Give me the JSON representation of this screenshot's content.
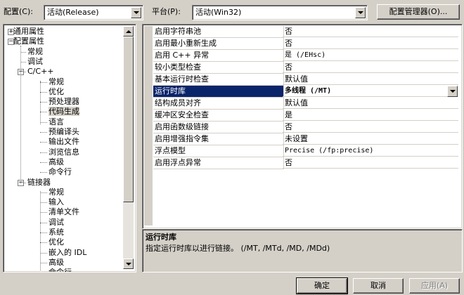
{
  "config": {
    "label": "配置(C):",
    "value": "活动(Release)"
  },
  "platform": {
    "label": "平台(P):",
    "value": "活动(Win32)"
  },
  "config_manager_button": "配置管理器(O)...",
  "tree": [
    {
      "text": "通用属性",
      "depth": 0,
      "expander": "+",
      "key": "common"
    },
    {
      "text": "配置属性",
      "depth": 0,
      "expander": "-",
      "key": "config"
    },
    {
      "text": "常规",
      "depth": 1,
      "key": "general"
    },
    {
      "text": "调试",
      "depth": 1,
      "key": "debugging"
    },
    {
      "text": "C/C++",
      "depth": 1,
      "expander": "-",
      "key": "cpp"
    },
    {
      "text": "常规",
      "depth": 2,
      "key": "cpp-general"
    },
    {
      "text": "优化",
      "depth": 2,
      "key": "cpp-optimization"
    },
    {
      "text": "预处理器",
      "depth": 2,
      "key": "cpp-preprocessor"
    },
    {
      "text": "代码生成",
      "depth": 2,
      "key": "cpp-codegen",
      "selected": true
    },
    {
      "text": "语言",
      "depth": 2,
      "key": "cpp-language"
    },
    {
      "text": "预编译头",
      "depth": 2,
      "key": "cpp-pch"
    },
    {
      "text": "输出文件",
      "depth": 2,
      "key": "cpp-output"
    },
    {
      "text": "浏览信息",
      "depth": 2,
      "key": "cpp-browse"
    },
    {
      "text": "高级",
      "depth": 2,
      "key": "cpp-advanced"
    },
    {
      "text": "命令行",
      "depth": 2,
      "key": "cpp-cmdline"
    },
    {
      "text": "链接器",
      "depth": 1,
      "expander": "-",
      "key": "linker"
    },
    {
      "text": "常规",
      "depth": 2,
      "key": "linker-general"
    },
    {
      "text": "输入",
      "depth": 2,
      "key": "linker-input"
    },
    {
      "text": "清单文件",
      "depth": 2,
      "key": "linker-manifest"
    },
    {
      "text": "调试",
      "depth": 2,
      "key": "linker-debug"
    },
    {
      "text": "系统",
      "depth": 2,
      "key": "linker-system"
    },
    {
      "text": "优化",
      "depth": 2,
      "key": "linker-optimization"
    },
    {
      "text": "嵌入的 IDL",
      "depth": 2,
      "key": "linker-idl"
    },
    {
      "text": "高级",
      "depth": 2,
      "key": "linker-advanced"
    },
    {
      "text": "命令行",
      "depth": 2,
      "key": "linker-cmdline"
    }
  ],
  "properties": [
    {
      "name": "启用字符串池",
      "value": "否"
    },
    {
      "name": "启用最小重新生成",
      "value": "否"
    },
    {
      "name": "启用 C++ 异常",
      "value": "是 (/EHsc)"
    },
    {
      "name": "较小类型检查",
      "value": "否"
    },
    {
      "name": "基本运行时检查",
      "value": "默认值"
    },
    {
      "name": "运行时库",
      "value": "多线程 (/MT)",
      "selected": true
    },
    {
      "name": "结构成员对齐",
      "value": "默认值"
    },
    {
      "name": "缓冲区安全检查",
      "value": "是"
    },
    {
      "name": "启用函数级链接",
      "value": "否"
    },
    {
      "name": "启用增强指令集",
      "value": "未设置"
    },
    {
      "name": "浮点模型",
      "value": "Precise (/fp:precise)"
    },
    {
      "name": "启用浮点异常",
      "value": "否"
    }
  ],
  "description": {
    "title": "运行时库",
    "text": "指定运行时库以进行链接。    (/MT, /MTd, /MD, /MDd)"
  },
  "buttons": {
    "ok": "确定",
    "cancel": "取消",
    "apply": "应用(A)"
  },
  "colors": {
    "selection": "#0a246a",
    "face": "#d4d0c8"
  }
}
